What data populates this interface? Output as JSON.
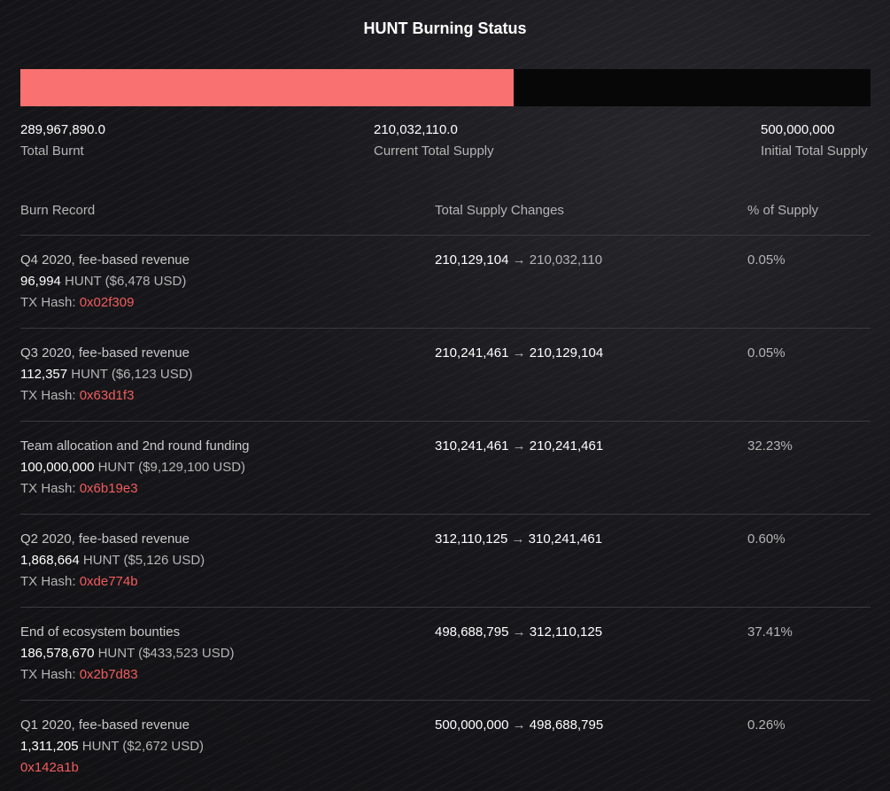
{
  "title": "HUNT Burning Status",
  "accent_color": "#f97170",
  "progress": {
    "burnt_fraction": 0.5799
  },
  "stats": {
    "burnt_value": "289,967,890.0",
    "burnt_label": "Total Burnt",
    "current_value": "210,032,110.0",
    "current_label": "Current Total Supply",
    "initial_value": "500,000,000",
    "initial_label": "Initial Total Supply"
  },
  "table": {
    "headers": {
      "record": "Burn Record",
      "changes": "Total Supply Changes",
      "percent": "% of Supply"
    },
    "rows": [
      {
        "desc": "Q4 2020, fee-based revenue",
        "amount": "96,994",
        "usd": " HUNT ($6,478 USD)",
        "tx_label": "TX Hash: ",
        "tx": "0x02f309",
        "from": "210,129,104",
        "arrow": " → ",
        "to": "210,032,110",
        "percent": "0.05%"
      },
      {
        "desc": "Q3 2020, fee-based revenue",
        "amount": "112,357",
        "usd": " HUNT ($6,123 USD)",
        "tx_label": "TX Hash: ",
        "tx": "0x63d1f3",
        "from": "210,241,461",
        "arrow": " → ",
        "to": "210,129,104",
        "percent": "0.05%"
      },
      {
        "desc": "Team allocation and 2nd round funding",
        "amount": "100,000,000",
        "usd": " HUNT ($9,129,100 USD)",
        "tx_label": "TX Hash: ",
        "tx": "0x6b19e3",
        "from": "310,241,461",
        "arrow": " → ",
        "to": "210,241,461",
        "percent": "32.23%"
      },
      {
        "desc": "Q2 2020, fee-based revenue",
        "amount": "1,868,664",
        "usd": " HUNT ($5,126 USD)",
        "tx_label": "TX Hash: ",
        "tx": "0xde774b",
        "from": "312,110,125",
        "arrow": " → ",
        "to": "310,241,461",
        "percent": "0.60%"
      },
      {
        "desc": "End of ecosystem bounties",
        "amount": "186,578,670",
        "usd": " HUNT ($433,523 USD)",
        "tx_label": "TX Hash: ",
        "tx": "0x2b7d83",
        "from": "498,688,795",
        "arrow": " → ",
        "to": "312,110,125",
        "percent": "37.41%"
      },
      {
        "desc": "Q1 2020, fee-based revenue",
        "amount": "1,311,205",
        "usd": " HUNT ($2,672 USD)",
        "tx_label": "",
        "tx": "0x142a1b",
        "from": "500,000,000",
        "arrow": " → ",
        "to": "498,688,795",
        "percent": "0.26%"
      }
    ]
  }
}
